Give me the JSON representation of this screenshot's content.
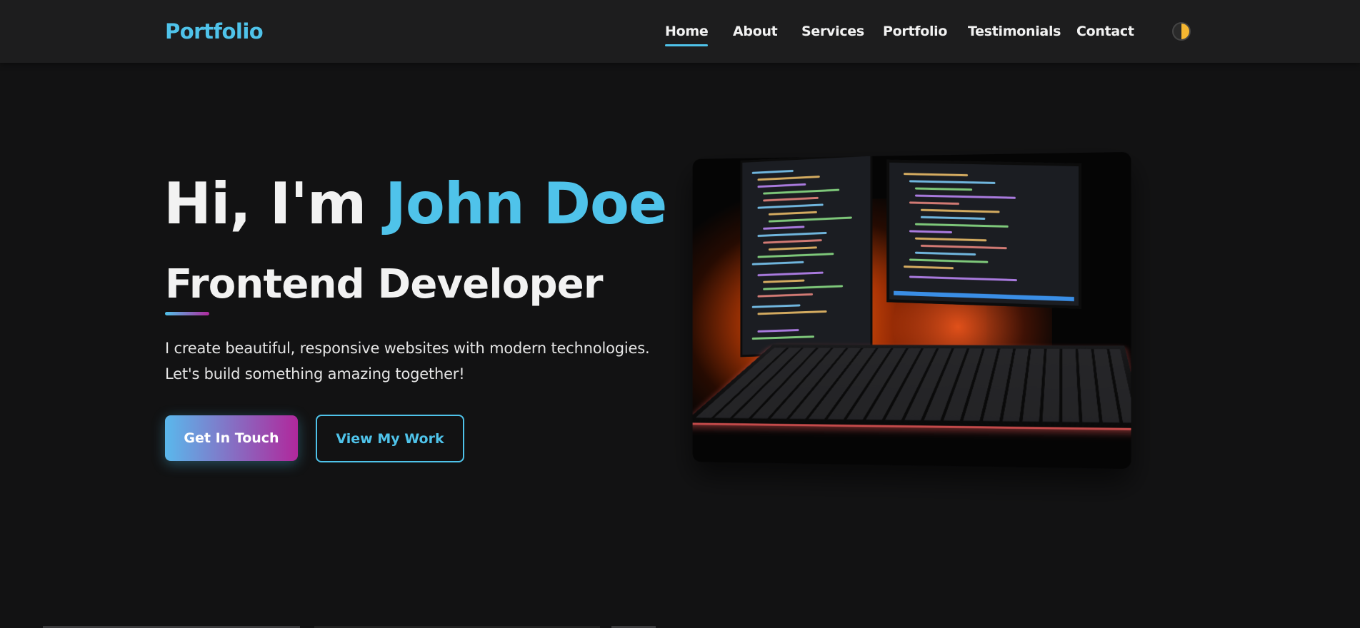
{
  "header": {
    "logo": "Portfolio",
    "nav": [
      {
        "label": "Home",
        "active": true
      },
      {
        "label": "About",
        "active": false
      },
      {
        "label": "Services",
        "active": false
      },
      {
        "label": "Portfolio",
        "active": false
      },
      {
        "label": "Testimonials",
        "active": false
      },
      {
        "label": "Contact",
        "active": false
      }
    ],
    "theme_toggle_icon": "theme-toggle-icon"
  },
  "hero": {
    "greeting": "Hi, I'm ",
    "name": "John Doe",
    "role": "Frontend Developer",
    "description": "I create beautiful, responsive websites with modern technologies. Let's build something amazing together!",
    "primary_button": "Get In Touch",
    "secondary_button": "View My Work",
    "image_subject": "laptop-code-image"
  },
  "colors": {
    "accent": "#4fc3ea",
    "accent_secondary": "#b0289c",
    "background": "#121213",
    "header_bg": "#1d1d1e"
  }
}
